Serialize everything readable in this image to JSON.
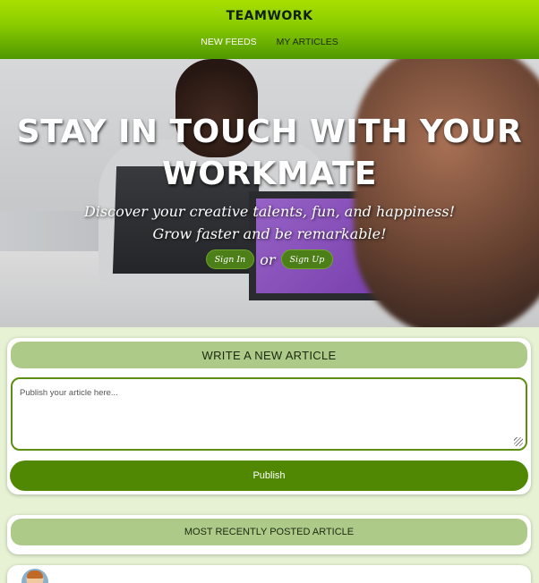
{
  "header": {
    "brand": "TEAMWORK",
    "nav": [
      {
        "label": "NEW FEEDS"
      },
      {
        "label": "MY ARTICLES"
      }
    ]
  },
  "hero": {
    "title": "STAY IN TOUCH WITH YOUR WORKMATE",
    "subtitle_line1": "Discover your creative talents, fun, and happiness!",
    "subtitle_line2": "Grow faster and be remarkable!",
    "signin_label": "Sign In",
    "or_label": "or",
    "signup_label": "Sign Up"
  },
  "write_article": {
    "heading": "WRITE A NEW ARTICLE",
    "placeholder": "Publish your article here...",
    "publish_label": "Publish"
  },
  "recent": {
    "heading": "MOST RECENTLY POSTED ARTICLE"
  },
  "colors": {
    "header_top": "#a9df00",
    "header_bottom": "#4f9800",
    "page_bg": "#e6f2d3",
    "section_head": "#aeca89",
    "publish_button": "#508804"
  }
}
